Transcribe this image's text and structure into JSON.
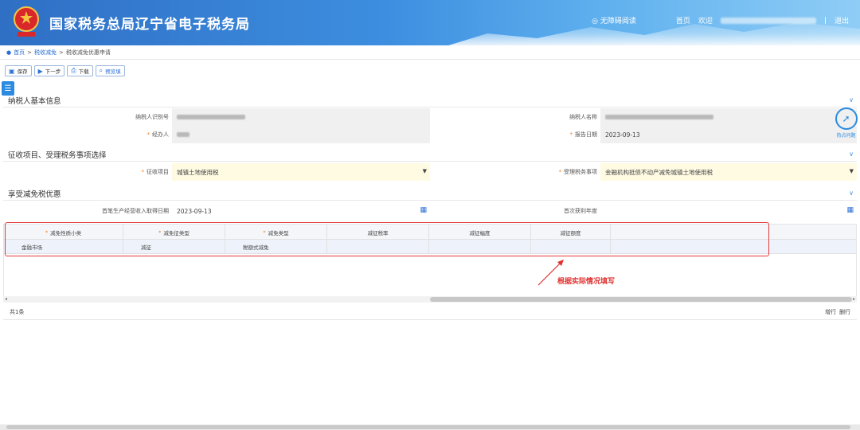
{
  "header": {
    "site_title": "国家税务总局辽宁省电子税务局",
    "accessibility_label": "无障碍阅读",
    "home_label": "首页",
    "welcome_label": "欢迎",
    "logout_label": "退出"
  },
  "breadcrumb": {
    "home": "首页",
    "level1": "税收减免",
    "current": "税收减免优惠申请",
    "sep": ">"
  },
  "toolbar": {
    "save": "保存",
    "next": "下一步",
    "download": "下载",
    "preview": "预览填"
  },
  "side_tab_glyph": "☰",
  "section_taxpayer": {
    "title": "纳税人基本信息",
    "id_label": "纳税人识别号",
    "name_label": "纳税人名称",
    "handler_label": "经办人",
    "report_date_label": "报告日期",
    "report_date_value": "2023-09-13"
  },
  "section_levy": {
    "title": "征收项目、受理税务事项选择",
    "item_label": "征收项目",
    "item_value": "城镇土地使用税",
    "matter_label": "受理税务事项",
    "matter_value": "金融机构抵债不动产减免城镇土地使用税"
  },
  "section_benefit": {
    "title": "享受减免税优惠",
    "first_income_label": "首笔生产经营收入取得日期",
    "first_income_value": "2023-09-13",
    "first_profit_label": "首次获利年度"
  },
  "grid": {
    "headers": [
      "减免性质小类",
      "减免征类型",
      "减免类型",
      "减征税率",
      "减征幅度",
      "减征额度"
    ],
    "rows": [
      [
        "金融市场",
        "减征",
        "税额式减免",
        "",
        "",
        ""
      ]
    ]
  },
  "annotation": "根据实际情况填写",
  "footer": {
    "total": "共1条",
    "add_row": "增行",
    "delete_row": "删行"
  },
  "help_label": "热点问题",
  "colors": {
    "accent": "#2a6fd6",
    "required": "#f07c1a",
    "annotation": "#e03030"
  }
}
